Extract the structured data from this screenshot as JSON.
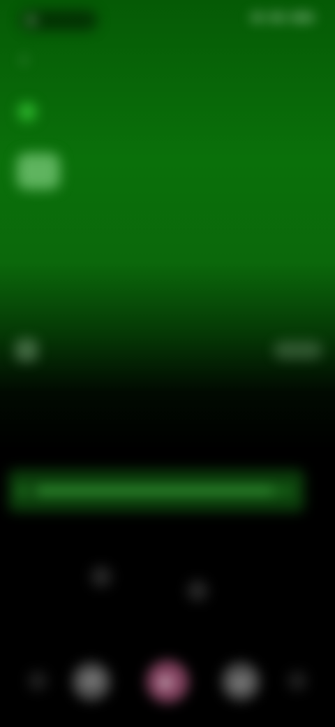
{
  "status_bar": {
    "time": "",
    "icons": [
      "signal-icon",
      "wifi-icon",
      "battery-icon"
    ]
  },
  "header": {
    "label": ""
  },
  "channel": {
    "name": ""
  },
  "description": "",
  "episode": {
    "title": "",
    "action_label": ""
  },
  "hint": "",
  "progress": {
    "fraction": 0.92
  },
  "section": {
    "label": ""
  },
  "colors": {
    "accent_green": "#0a700a",
    "play_pink": "#dc6ea0",
    "background": "#000000"
  }
}
